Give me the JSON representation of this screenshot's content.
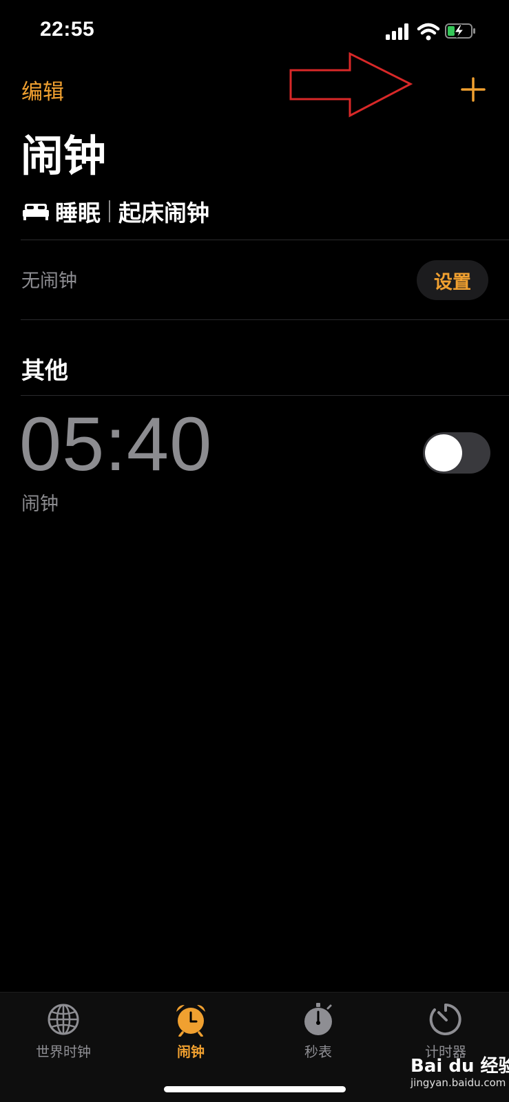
{
  "status_bar": {
    "time": "22:55"
  },
  "nav": {
    "edit_label": "编辑",
    "title": "闹钟"
  },
  "sleep": {
    "title_left": "睡眠",
    "title_right": "起床闹钟",
    "no_alarm": "无闹钟",
    "setup_button": "设置"
  },
  "other": {
    "section_title": "其他",
    "alarms": [
      {
        "time": "05:40",
        "label": "闹钟",
        "enabled": false
      }
    ]
  },
  "tabs": [
    {
      "label": "世界时钟",
      "icon": "globe-icon",
      "active": false
    },
    {
      "label": "闹钟",
      "icon": "alarm-clock-icon",
      "active": true
    },
    {
      "label": "秒表",
      "icon": "stopwatch-icon",
      "active": false
    },
    {
      "label": "计时器",
      "icon": "timer-icon",
      "active": false
    }
  ],
  "watermark": {
    "brand": "Bai du 经验",
    "url": "jingyan.baidu.com"
  },
  "colors": {
    "accent": "#f0a030",
    "background": "#000000",
    "secondary_text": "#8c8c90",
    "annotation": "#d82828"
  }
}
